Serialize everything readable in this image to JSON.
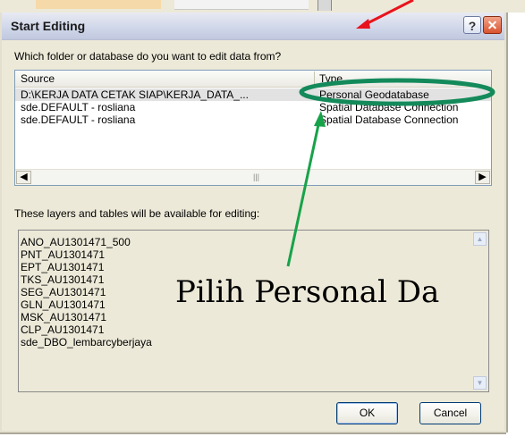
{
  "dialog": {
    "title": "Start Editing",
    "help_label": "?",
    "question": "Which folder or database do you want to edit data from?",
    "columns": [
      "Source",
      "Type"
    ],
    "rows": [
      {
        "source": "D:\\KERJA DATA CETAK SIAP\\KERJA_DATA_...",
        "type": "Personal Geodatabase",
        "selected": true
      },
      {
        "source": "sde.DEFAULT - rosliana",
        "type": "Spatial Database Connection",
        "selected": false
      },
      {
        "source": "sde.DEFAULT - rosliana",
        "type": "Spatial Database Connection",
        "selected": false
      }
    ],
    "available_label": "These layers and tables will be available for editing:",
    "layers": [
      "ANO_AU1301471_500",
      "PNT_AU1301471",
      "EPT_AU1301471",
      "TKS_AU1301471",
      "SEG_AU1301471",
      "GLN_AU1301471",
      "MSK_AU1301471",
      "CLP_AU1301471",
      "sde_DBO_lembarcyberjaya"
    ],
    "ok_label": "OK",
    "cancel_label": "Cancel"
  },
  "annotation": {
    "text": "Pilih Personal Da",
    "arrow_color": "#17a34a",
    "ellipse_color": "#17a34a",
    "red_arrow_color": "#e8141c"
  }
}
